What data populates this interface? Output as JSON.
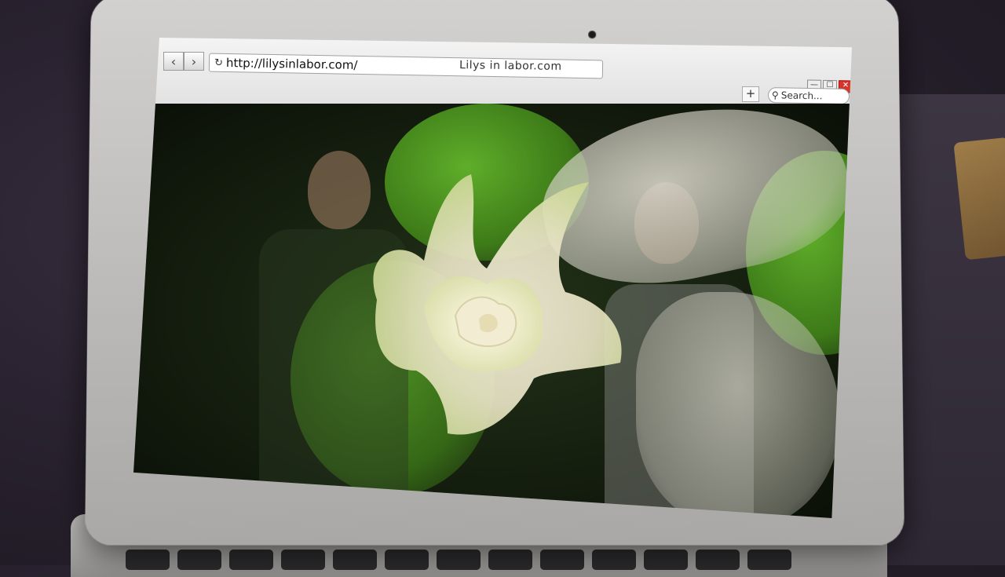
{
  "browser": {
    "window_title": "Lilys in labor.com",
    "url": "http://lilysinlabor.com/",
    "back_icon": "chevron-left-icon",
    "forward_icon": "chevron-right-icon",
    "reload_icon": "reload-icon",
    "new_tab_label": "+",
    "search_placeholder": "Search...",
    "controls": {
      "minimize": "—",
      "maximize": "☐",
      "close": "✕"
    }
  },
  "colors": {
    "close_button": "#d9342b",
    "chrome": "#e8e8e8",
    "laptop_bezel": "#c4c3c1"
  }
}
